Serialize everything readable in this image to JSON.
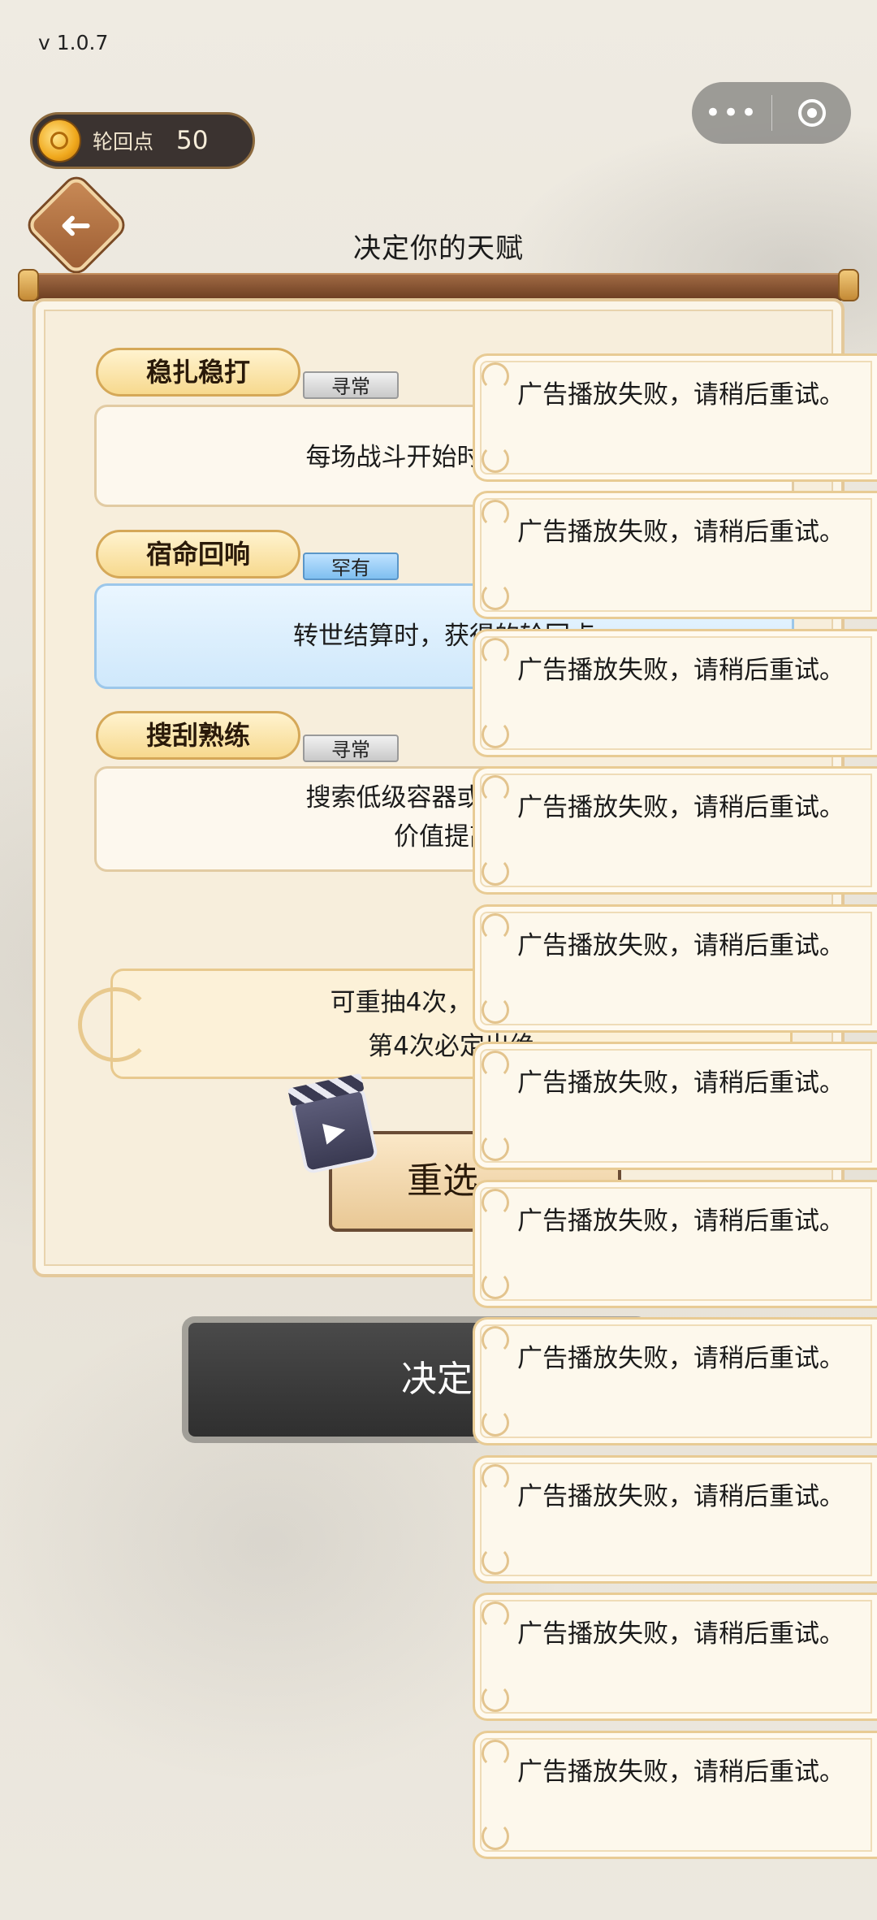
{
  "status_bar": {
    "version": "v 1.0.7"
  },
  "capsule": {
    "more_glyph": "•••",
    "more_icon": "more-dots-icon",
    "close_icon": "target-close-icon"
  },
  "points": {
    "label": "轮回点",
    "value": "50",
    "icon": "coin-icon"
  },
  "header": {
    "back_icon": "back-arrow-icon",
    "back_glyph": "➜",
    "title": "决定你的天赋"
  },
  "talents": [
    {
      "name": "稳扎稳打",
      "rarity": "寻常",
      "rarity_type": "common",
      "description": "每场战斗开始时，获得气"
    },
    {
      "name": "宿命回响",
      "rarity": "罕有",
      "rarity_type": "rare",
      "description": "转世结算时，获得的轮回点"
    },
    {
      "name": "搜刮熟练",
      "rarity": "寻常",
      "rarity_type": "common",
      "description_line1": "搜索低级容器或中级容器",
      "description_line2": "价值提高"
    }
  ],
  "hint": {
    "line1": "可重抽4次，每次都会",
    "line2": "第4次必定出绝"
  },
  "reroll": {
    "label": "重选",
    "icon": "video-ad-icon",
    "icon_glyph": "▶"
  },
  "confirm": {
    "label": "决定"
  },
  "toasts": [
    "广告播放失败，请稍后重试。",
    "广告播放失败，请稍后重试。",
    "广告播放失败，请稍后重试。",
    "广告播放失败，请稍后重试。",
    "广告播放失败，请稍后重试。",
    "广告播放失败，请稍后重试。",
    "广告播放失败，请稍后重试。",
    "广告播放失败，请稍后重试。",
    "广告播放失败，请稍后重试。",
    "广告播放失败，请稍后重试。",
    "广告播放失败，请稍后重试。"
  ],
  "colors": {
    "panel": "#f7eedc",
    "rare_blue": "#7fbff0",
    "accent_gold": "#f7d98e",
    "dark_button": "#2f2f2f"
  }
}
